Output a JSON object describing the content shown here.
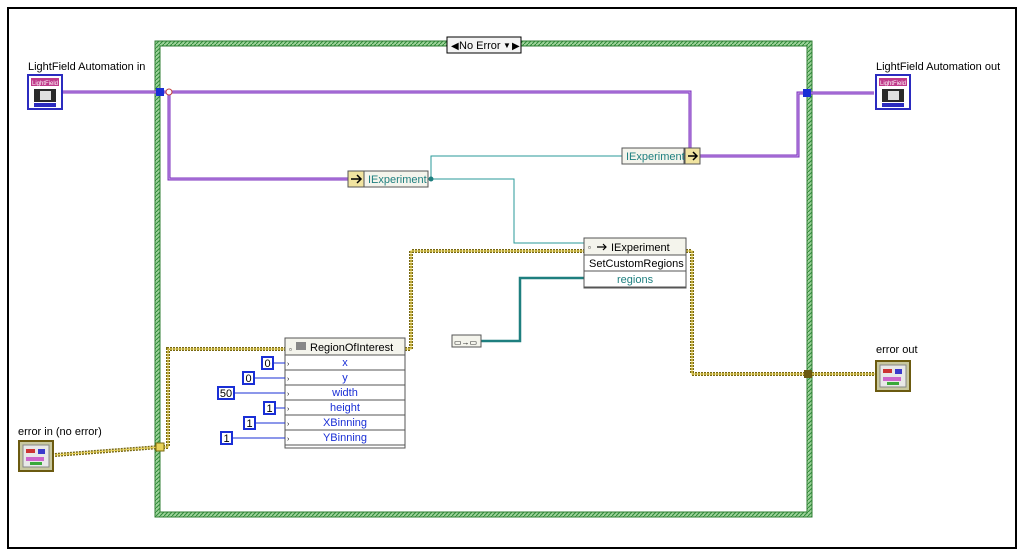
{
  "terminals": {
    "automation_in": "LightField Automation in",
    "automation_out": "LightField Automation out",
    "error_in": "error in (no error)",
    "error_out": "error out",
    "icon_text": "LightField"
  },
  "case_structure": {
    "selector_label": "No Error",
    "left_arrow": "◀",
    "dropdown": "▼",
    "right_arrow": "▶"
  },
  "nodes": {
    "iexperiment_top": "IExperiment",
    "iexperiment_mid": "IExperiment",
    "invoke_class": "IExperiment",
    "invoke_method": "SetCustomRegions",
    "invoke_param": "regions",
    "roi_class": "RegionOfInterest",
    "roi_fields": [
      "x",
      "y",
      "width",
      "height",
      "XBinning",
      "YBinning"
    ],
    "build_array": "▭→▭"
  },
  "constants": [
    "0",
    "0",
    "50",
    "1",
    "1",
    "1"
  ],
  "colors": {
    "purple_wire": "#7b2fbe",
    "teal_wire": "#2a9a9a",
    "error_wire": "#8a7a1a",
    "case_border": "#4caf50",
    "constant_blue": "#1a2fd6"
  }
}
